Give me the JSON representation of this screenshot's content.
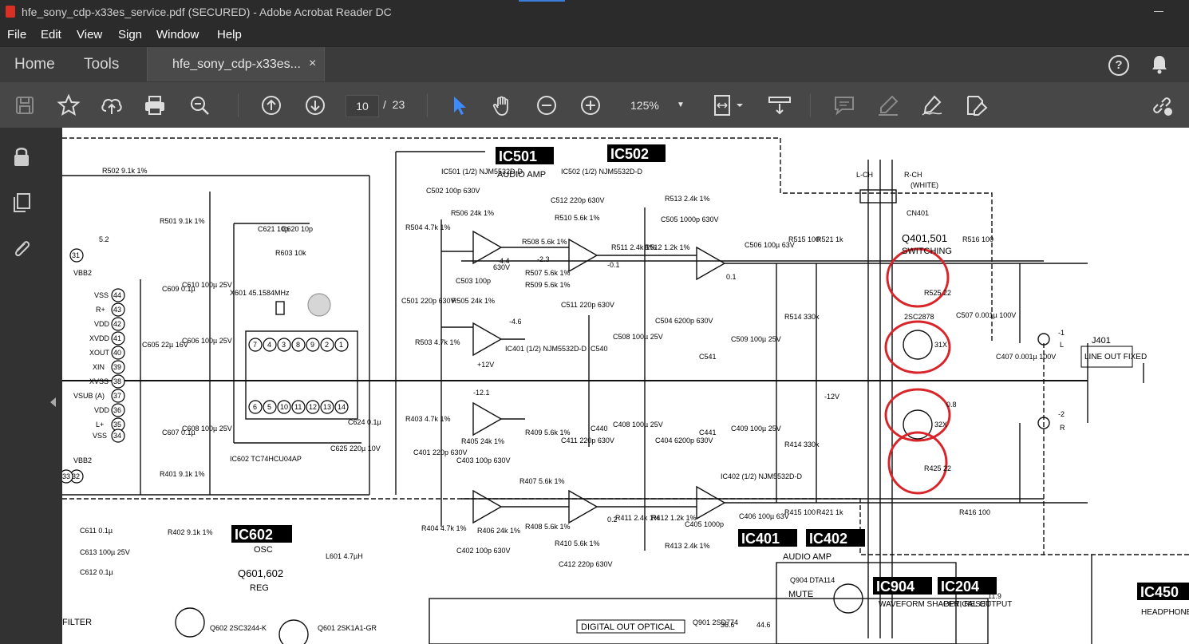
{
  "window": {
    "title": "hfe_sony_cdp-x33es_service.pdf (SECURED) - Adobe Acrobat Reader DC"
  },
  "menu": [
    "File",
    "Edit",
    "View",
    "Sign",
    "Window",
    "Help"
  ],
  "tabs": {
    "home": "Home",
    "tools": "Tools",
    "document": "hfe_sony_cdp-x33es...",
    "close": "×",
    "help": "?"
  },
  "toolbar": {
    "page_current": "10",
    "page_sep": "/",
    "page_total": "23",
    "zoom": "125%"
  },
  "icons": [
    "save-icon",
    "bookmark-star-icon",
    "upload-icon",
    "print-icon",
    "zoom-search-icon",
    "page-up-icon",
    "page-down-icon",
    "select-cursor-icon",
    "hand-icon",
    "zoom-out-icon",
    "zoom-in-icon",
    "fit-page-icon",
    "scroll-mode-icon",
    "comment-icon",
    "highlight-icon",
    "sign-icon",
    "fill-sign-icon",
    "share-link-icon",
    "lock-icon",
    "pages-icon",
    "attachment-icon",
    "bell-icon"
  ],
  "schematic": {
    "ic501": "IC501",
    "ic502": "IC502",
    "ic602": "IC602",
    "ic401": "IC401",
    "ic402": "IC402",
    "ic904": "IC904",
    "ic204": "IC204",
    "ic450": "IC450",
    "audio_amp": "AUDIO AMP",
    "audio_amp_bar": "AUDIO AMP",
    "osc": "OSC",
    "q601_602": "Q601,602",
    "reg": "REG",
    "q401_501": "Q401,501",
    "switching": "SWITCHING",
    "cn401": "CN401",
    "j401": "J401",
    "line_out_fixed": "LINE OUT FIXED",
    "waveform": "WAVEFORM SHAPER, RESET",
    "optical_output": "OPTICAL OUTPUT",
    "digital_out": "DIGITAL OUT OPTICAL",
    "headphone": "HEADPHONE AMP",
    "mute": "MUTE",
    "q904": "Q904 DTA114",
    "q901": "Q901 2SD774",
    "filter": "FILTER",
    "labels": [
      "R502 9.1k 1%",
      "R501 9.1k 1%",
      "C502 100p 630V",
      "R506 24k 1%",
      "R504 4.7k 1%",
      "R508 5.6k 1%",
      "C512 220p 630V",
      "R510 5.6k 1%",
      "R511 2.4k 1%",
      "R512 1.2k 1%",
      "R513 2.4k 1%",
      "C505 1000p 630V",
      "C506 100µ 63V",
      "R515 100",
      "R521 1k",
      "R516 100",
      "R525 22",
      "C507 0.001µ 100V",
      "R514 330k",
      "C407 0.001µ 100V",
      "R414 330k",
      "R415 100",
      "R421 1k",
      "R416 100",
      "R425 22",
      "C406 100µ 63V",
      "C405 1000p",
      "R413 2.4k 1%",
      "R412 1.2k 1%",
      "R411 2.4k 1%",
      "C412 220p 630V",
      "R410 5.6k 1%",
      "R408 5.6k 1%",
      "R407 5.6k 1%",
      "R406 24k 1%",
      "C402 100p 630V",
      "R404 4.7k 1%",
      "R405 24k 1%",
      "C403 100p 630V",
      "R403 4.7k 1%",
      "C401 220p 630V",
      "R503 4.7k 1%",
      "R505 24k 1%",
      "C503 100p",
      "R507 5.6k 1%",
      "R509 5.6k 1%",
      "C511 220p 630V",
      "C540",
      "C508 100µ 25V",
      "C504 6200p 630V",
      "C541",
      "C509 100µ 25V",
      "C440",
      "C408 100µ 25V",
      "C404 6200p 630V",
      "C441",
      "C409 100µ 25V",
      "C411 220p 630V",
      "R409 5.6k 1%",
      "C501 220p 630V",
      "C621 10p",
      "C620 10p",
      "R603 10k",
      "X601 45.1584MHz",
      "C605 22µ 16V",
      "C606 100µ 25V",
      "C609 0.1µ",
      "C610 100µ 25V",
      "C607 0.1µ",
      "C608 100µ 25V",
      "C611 0.1µ",
      "C613 100µ 25V",
      "C612 0.1µ",
      "R402 9.1k 1%",
      "R401 9.1k 1%",
      "C624 0.1µ",
      "C625 220µ 10V",
      "L601 4.7µH",
      "IC602 TC74HCU04AP",
      "IC501 (1/2) NJM5532D-D",
      "IC502 (1/2) NJM5532D-D",
      "IC401 (1/2) NJM5532D-D",
      "IC402 (1/2) NJM5532D-D",
      "Q602 2SC3244-K",
      "Q601 2SK1A1-GR",
      "2SC2878",
      "630V",
      "5.2",
      "11.9",
      "-12V",
      "0.8",
      "-0.1",
      "0.1",
      "0.2",
      "-4.4",
      "-4.6",
      "-2.3",
      "-12.1",
      "+12V",
      "36.6",
      "44.6",
      "L-CH",
      "R-CH",
      "(WHITE)",
      "-1",
      "-2",
      "L",
      "R"
    ],
    "pins": [
      "VSS",
      "R+",
      "VDD",
      "XVDD",
      "XOUT",
      "XIN",
      "XVSS",
      "VSUB (A)",
      "VDD",
      "L+",
      "VSS",
      "VBB2",
      "VBB2",
      "44",
      "43",
      "42",
      "41",
      "40",
      "39",
      "38",
      "37",
      "36",
      "35",
      "34",
      "33",
      "32",
      "31",
      "7",
      "4",
      "3",
      "8",
      "9",
      "2",
      "1",
      "6",
      "5",
      "10",
      "11",
      "12",
      "13",
      "14",
      "31X",
      "32X"
    ]
  }
}
